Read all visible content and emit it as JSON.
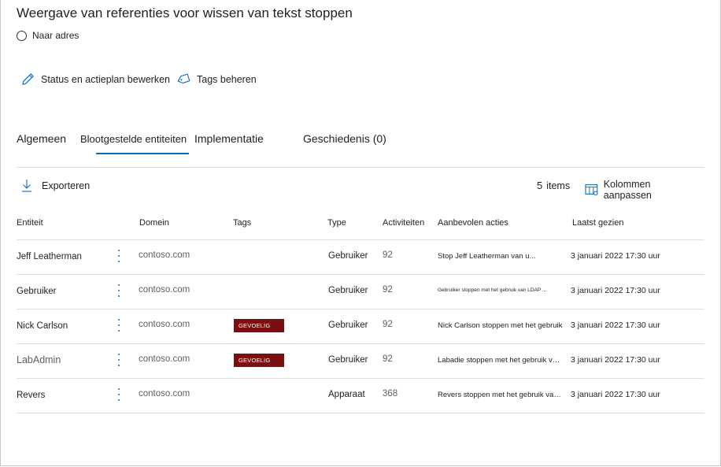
{
  "page": {
    "title": "Weergave van referenties voor wissen van tekst stoppen",
    "radio_label": "Naar adres"
  },
  "actions": {
    "edit_label": "Status en actieplan bewerken",
    "tags_label": "Tags beheren"
  },
  "tabs": [
    {
      "label": "Algemeen"
    },
    {
      "label": "Blootgestelde entiteiten"
    },
    {
      "label": "Implementatie"
    },
    {
      "label": "Geschiedenis (0)"
    }
  ],
  "toolbar": {
    "export_label": "Exporteren",
    "count_num": "5",
    "count_label": "items",
    "columns_label": "Kolommen aanpassen"
  },
  "table": {
    "headers": [
      "Entiteit",
      "Domein",
      "Tags",
      "Type",
      "Activiteiten",
      "Aanbevolen acties",
      "Laatst gezien"
    ],
    "rows": [
      {
        "entity": "Jeff Leatherman",
        "domain": "contoso.com",
        "tag": "",
        "type": "Gebruiker",
        "activities": "92",
        "recommended": "Stop Jeff Leatherman van u...",
        "last_seen": "3 januari 2022 17:30 uur"
      },
      {
        "entity": "Gebruiker",
        "domain": "contoso.com",
        "tag": "",
        "type": "Gebruiker",
        "activities": "92",
        "recommended": "Gebruiker stoppen met het gebruik van LDAP ...",
        "last_seen": "3 januari 2022 17:30 uur"
      },
      {
        "entity": "Nick Carlson",
        "domain": "contoso.com",
        "tag": "GEVOELIG",
        "type": "Gebruiker",
        "activities": "92",
        "recommended": "Nick Carlson stoppen met het gebruik",
        "last_seen": "3 januari 2022 17:30 uur"
      },
      {
        "entity": "LabAdmin",
        "domain": "contoso.com",
        "tag": "GEVOELIG",
        "type": "Gebruiker",
        "activities": "92",
        "recommended": "Labadie stoppen met het gebruik van L...",
        "last_seen": "3 januari 2022 17:30 uur"
      },
      {
        "entity": "Revers",
        "domain": "contoso.com",
        "tag": "",
        "type": "Apparaat",
        "activities": "368",
        "recommended": "Revers stoppen met het gebruik van L...",
        "last_seen": "3 januari 2022 17:30 uur"
      }
    ]
  },
  "colors": {
    "accent": "#0f6cbd",
    "tag_bg": "#7b0e0e",
    "divider": "#e1dfdd"
  },
  "icons": {
    "radio": "radio-icon",
    "edit": "pencil-icon",
    "tags": "tag-icon",
    "export": "download-icon",
    "columns": "columns-icon",
    "more": "more-vertical-icon"
  }
}
